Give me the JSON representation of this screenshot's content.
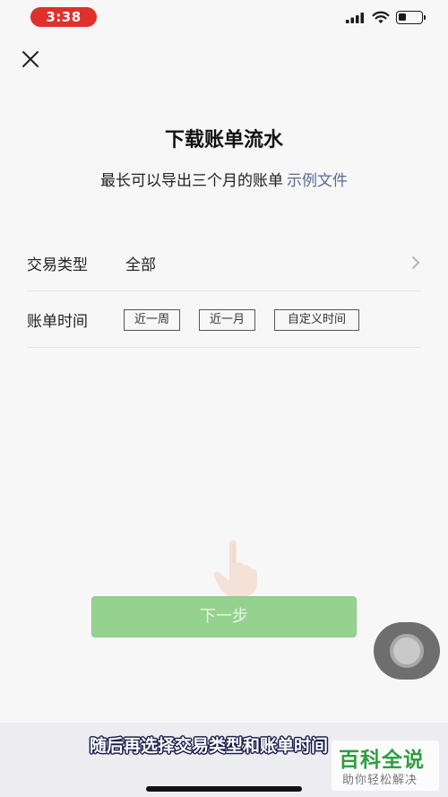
{
  "status_bar": {
    "time": "3:38",
    "battery_level": 0.35
  },
  "icons": {
    "close": "close-icon",
    "signal": "signal-icon",
    "wifi": "wifi-icon",
    "battery": "battery-icon",
    "chevron": "chevron-right-icon",
    "hand": "hand-pointer-icon"
  },
  "header": {
    "title": "下载账单流水",
    "subtitle": "最长可以导出三个月的账单",
    "sample_link": "示例文件"
  },
  "form": {
    "transaction_type": {
      "label": "交易类型",
      "value": "全部"
    },
    "bill_time": {
      "label": "账单时间",
      "options": [
        "近一周",
        "近一月",
        "自定义时间"
      ]
    }
  },
  "actions": {
    "next_label": "下一步"
  },
  "caption": {
    "text": "随后再选择交易类型和账单时间"
  },
  "watermark": {
    "title": "百科全说",
    "subtitle": "助你轻松解决"
  },
  "colors": {
    "status_time_bg": "#e0302b",
    "link": "#576b95",
    "next_button_bg": "#96d28f",
    "watermark_green": "#2e9e3e"
  }
}
